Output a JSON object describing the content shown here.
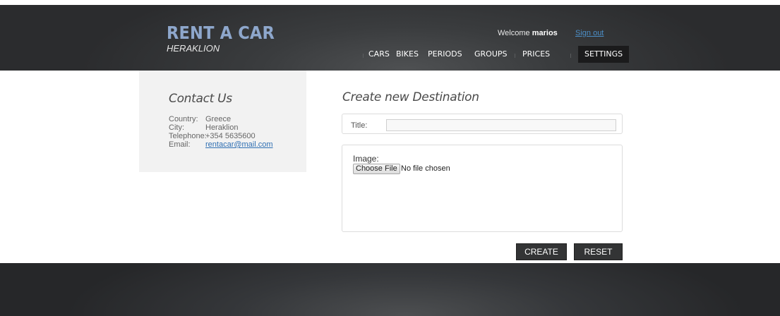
{
  "header": {
    "brand_title": "RENT A CAR",
    "brand_subtitle": "HERAKLION",
    "welcome_prefix": "Welcome",
    "username": "marios",
    "sign_out": "Sign out"
  },
  "nav": {
    "items": [
      {
        "label": "CARS"
      },
      {
        "label": "BIKES"
      },
      {
        "label": "PERIODS"
      },
      {
        "label": "GROUPS"
      },
      {
        "label": "PRICES"
      },
      {
        "label": "SETTINGS",
        "active": true
      }
    ]
  },
  "sidebar": {
    "title": "Contact Us",
    "rows": [
      {
        "key": "Country:",
        "value": "Greece"
      },
      {
        "key": "City:",
        "value": "Heraklion"
      },
      {
        "key": "Telephone:",
        "value": "+354 5635600"
      },
      {
        "key": "Email:",
        "value": "rentacar@mail.com"
      }
    ]
  },
  "form": {
    "page_title": "Create new Destination",
    "title_label": "Title:",
    "title_value": "",
    "image_label": "Image:",
    "choose_file": "Choose File",
    "no_file": "No file chosen",
    "create": "CREATE",
    "reset": "RESET"
  },
  "colors": {
    "brand": "#8ea7cc",
    "link": "#4c8ec6",
    "header_bg": "#2b2c2e",
    "button_bg": "#333435"
  }
}
